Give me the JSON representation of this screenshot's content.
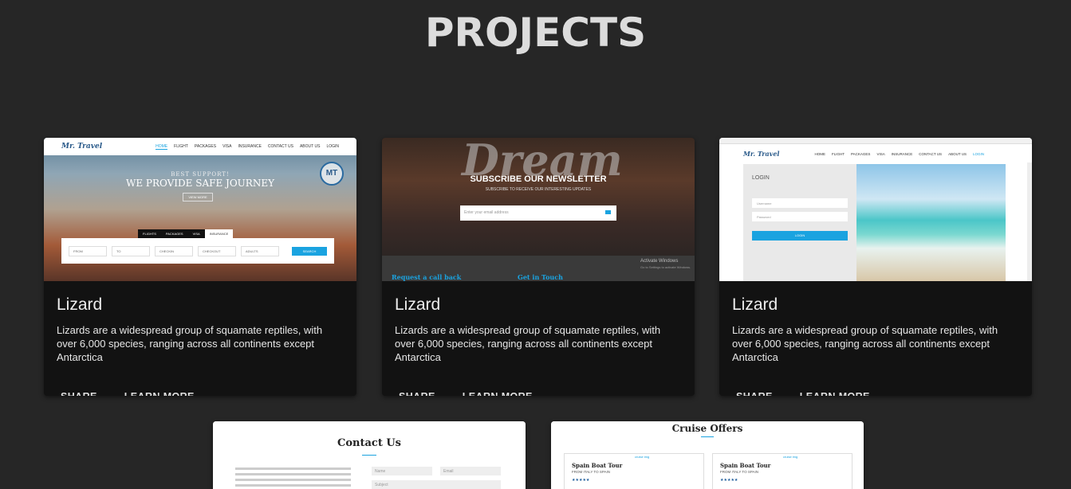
{
  "page": {
    "title": "PROJECTS"
  },
  "cards": [
    {
      "title": "Lizard",
      "description": "Lizards are a widespread group of squamate reptiles, with over 6,000 species, ranging across all continents except Antarctica",
      "share_label": "SHARE",
      "learn_more_label": "LEARN MORE"
    },
    {
      "title": "Lizard",
      "description": "Lizards are a widespread group of squamate reptiles, with over 6,000 species, ranging across all continents except Antarctica",
      "share_label": "SHARE",
      "learn_more_label": "LEARN MORE"
    },
    {
      "title": "Lizard",
      "description": "Lizards are a widespread group of squamate reptiles, with over 6,000 species, ranging across all continents except Antarctica",
      "share_label": "SHARE",
      "learn_more_label": "LEARN MORE"
    }
  ],
  "thumbs": {
    "travel": {
      "logo": "Mr. Travel",
      "nav": [
        "HOME",
        "FLIGHT",
        "PACKAGES",
        "VISA",
        "INSURANCE",
        "CONTACT US",
        "ABOUT US",
        "LOGIN"
      ],
      "hero_small": "BEST SUPPORT!",
      "hero_big": "WE PROVIDE SAFE JOURNEY",
      "more_btn": "VIEW MORE",
      "tabs": [
        "FLIGHTS",
        "PACKAGES",
        "VISA",
        "INSURANCE"
      ],
      "fields": [
        "FROM",
        "TO",
        "CHECKIN",
        "CHECKOUT",
        "ADULTS"
      ],
      "search_btn": "SEARCH",
      "badge": "MT"
    },
    "newsletter": {
      "bg_word": "Dream",
      "heading": "SUBSCRIBE OUR NEWSLETTER",
      "subheading": "SUBSCRIBE TO RECEIVE OUR INTERESTING UPDATES",
      "email_placeholder": "Enter your email address",
      "callback": "Request a call back",
      "touch": "Get in Touch",
      "windows_1": "Activate Windows",
      "windows_2": "Go to Settings to activate Windows."
    },
    "login": {
      "logo": "Mr. Travel",
      "nav": [
        "HOME",
        "FLIGHT",
        "PACKAGES",
        "VISA",
        "INSURANCE",
        "CONTACT US",
        "ABOUT US",
        "LOGIN"
      ],
      "heading": "LOGIN",
      "username": "Username",
      "password": "Password",
      "button": "LOGIN"
    },
    "contact": {
      "heading": "Contact Us",
      "name_placeholder": "Name",
      "email_placeholder": "Email",
      "subject_placeholder": "Subject"
    },
    "cruise": {
      "heading": "Cruise Offers",
      "items": [
        {
          "title": "Spain Boat Tour",
          "subtitle": "FROM ITALY TO SPAIN",
          "img_alt": "cruise img"
        },
        {
          "title": "Spain Boat Tour",
          "subtitle": "FROM ITALY TO SPAIN",
          "img_alt": "cruise img"
        }
      ]
    }
  },
  "colors": {
    "background": "#262626",
    "card": "#121212",
    "accent": "#1aa3e0"
  }
}
